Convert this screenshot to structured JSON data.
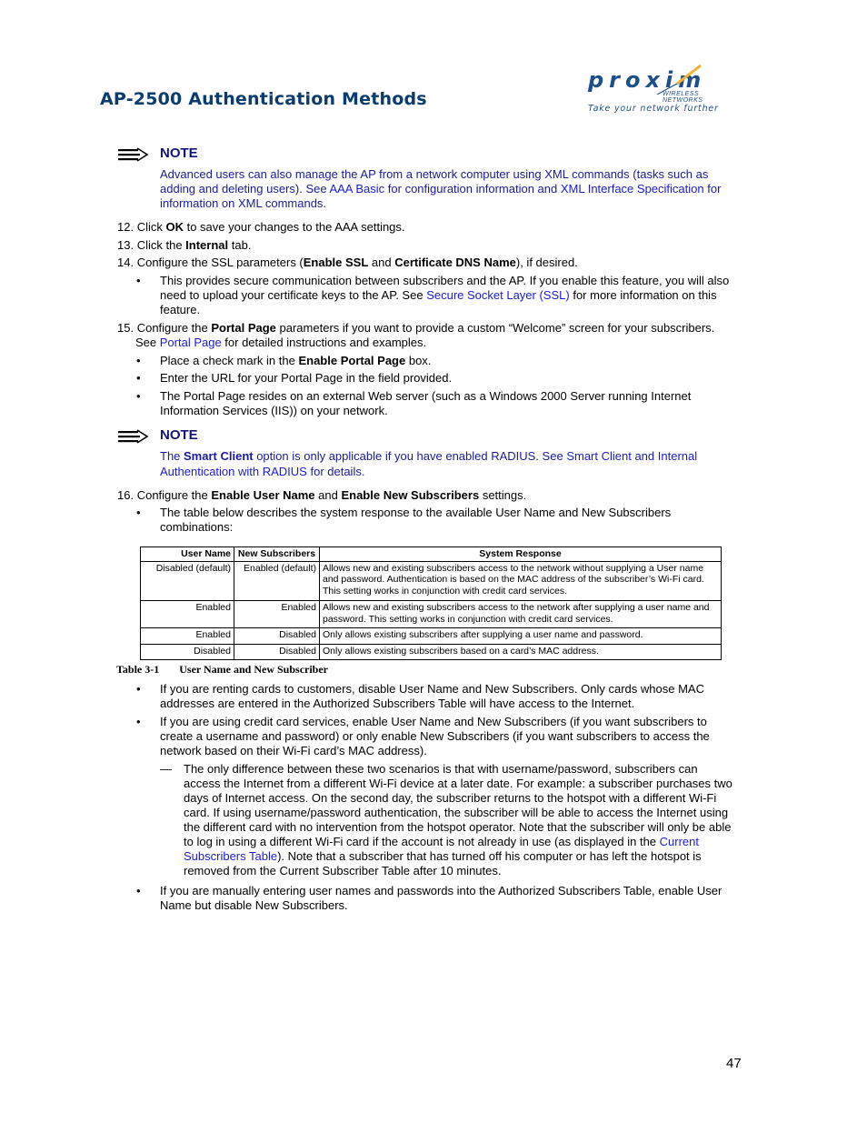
{
  "header": {
    "title": "AP-2500 Authentication Methods",
    "logo": {
      "wordmark": "proxim",
      "subtitle": "WIRELESS NETWORKS",
      "tagline": "Take your network further"
    }
  },
  "note1": {
    "icon": "note-arrow-icon",
    "heading": "NOTE",
    "t1": "Advanced users can also manage the AP from a network computer using XML commands (tasks such as",
    "t2a": "adding and deleting users). See ",
    "link1": "AAA Basic",
    "t2b": " for configuration information and ",
    "link2": "XML Interface Specification",
    "t2c": " for",
    "t3": "information on XML commands."
  },
  "steps": {
    "s12": {
      "num": "12.",
      "a": "Click ",
      "b": "OK",
      "c": " to save your changes to the AAA settings."
    },
    "s13": {
      "num": "13.",
      "a": "Click the ",
      "b": "Internal",
      "c": " tab."
    },
    "s14": {
      "num": "14.",
      "a": "Configure the SSL parameters (",
      "b1": "Enable SSL",
      "m": " and ",
      "b2": "Certificate DNS Name",
      "c": "), if desired.",
      "bullet": {
        "l1": "This provides secure communication between subscribers and the AP. If you enable this feature, you will also",
        "l2a": "need to upload your certificate keys to the AP. See ",
        "link": "Secure Socket Layer (SSL)",
        "l2b": " for more information on this",
        "l3": "feature."
      }
    },
    "s15": {
      "num": "15.",
      "a": "Configure the ",
      "b": "Portal Page",
      "c": " parameters if you want to provide a custom “Welcome” screen for your subscribers.",
      "l2a": "See ",
      "link": "Portal Page",
      "l2b": " for detailed instructions and examples.",
      "b1a": "Place a check mark in the ",
      "b1b": "Enable Portal Page",
      "b1c": " box.",
      "b2": "Enter the URL for your Portal Page in the field provided.",
      "b3l1": "The Portal Page resides on an external Web server (such as a Windows 2000 Server running Internet",
      "b3l2": "Information Services (IIS)) on your network."
    },
    "s16": {
      "num": "16.",
      "a": "Configure the ",
      "b1": "Enable User Name",
      "m": " and ",
      "b2": "Enable New Subscribers",
      "c": " settings.",
      "bl1": "The table below describes the system response to the available User Name and New Subscribers",
      "bl2": "combinations:"
    }
  },
  "note2": {
    "heading": "NOTE",
    "a": "The ",
    "b": "Smart Client",
    "c": " option is only applicable if you have enabled RADIUS. See ",
    "link1": "Smart Client",
    "d": " and ",
    "link2a": "Internal",
    "link2b": "Authentication with RADIUS",
    "e": " for details."
  },
  "table": {
    "headers": [
      "User Name",
      "New Subscribers",
      "System Response"
    ],
    "rows": [
      [
        "Disabled (default)",
        "Enabled (default)",
        "Allows new and existing subscribers access to the network without supplying a User name and password. Authentication is based on the MAC address of the subscriber’s Wi-Fi card. This setting works in conjunction with credit card services."
      ],
      [
        "Enabled",
        "Enabled",
        "Allows new and existing subscribers access to the network after supplying a user name and password. This setting works in conjunction with credit card services."
      ],
      [
        "Enabled",
        "Disabled",
        "Only allows existing subscribers after supplying a user name and password."
      ],
      [
        "Disabled",
        "Disabled",
        "Only allows existing subscribers based on a card’s MAC address."
      ]
    ],
    "caption_num": "Table 3-1",
    "caption_text": "User Name and New Subscriber"
  },
  "after": {
    "b1l1": "If you are renting cards to customers, disable User Name and New Subscribers. Only cards whose MAC",
    "b1l2": "addresses are entered in the Authorized Subscribers Table will have access to the Internet.",
    "b2l1": "If you are using credit card services, enable User Name and New Subscribers (if you want subscribers to",
    "b2l2": "create a username and password) or only enable New Subscribers (if you want subscribers to access the",
    "b2l3": "network based on their Wi-Fi card’s MAC address).",
    "dash": "—",
    "d1": "The only difference between these two scenarios is that with username/password, subscribers can",
    "d2": "access the Internet from a different Wi-Fi device at a later date. For example: a subscriber purchases two",
    "d3": "days of Internet access. On the second day, the subscriber returns to the hotspot with a different Wi-Fi",
    "d4": "card. If using username/password authentication, the subscriber will be able to access the Internet using",
    "d5": "the different card with no intervention from the hotspot operator. Note that the subscriber will only be able",
    "d6a": "to log in using a different Wi-Fi card if the account is not already in use (as displayed in the ",
    "d6link": "Current",
    "d7link": "Subscribers Table",
    "d7b": "). Note that a subscriber that has turned off his computer or has left the hotspot is",
    "d8": "removed from the Current Subscriber Table after 10 minutes.",
    "b3l1": "If you are manually entering user names and passwords into the Authorized Subscribers Table, enable User",
    "b3l2": "Name but disable New Subscribers."
  },
  "bullet_glyph": "•",
  "page_number": "47"
}
